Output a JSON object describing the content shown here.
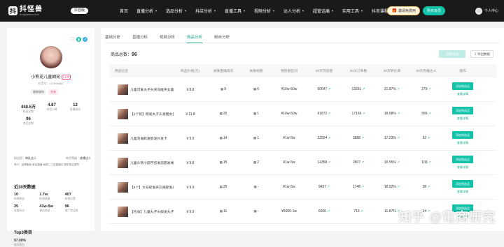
{
  "header": {
    "logo_mark": "抖",
    "logo_title": "抖怪兽",
    "logo_url": "douguaishou.com",
    "version": "抖音版",
    "nav": [
      "首页",
      "直播分析",
      "选品分析",
      "抖店分析",
      "直播工具",
      "视频分析",
      "达人分析",
      "超管话痛",
      "实用工具",
      "抖音课程"
    ],
    "invite_label": "邀请免费用",
    "buy_label": "购买会员",
    "user_label": "个人中心"
  },
  "shop": {
    "name": "小熊花儿童嫡宛",
    "level": "LV.5",
    "id_text": "抖音号：167898864",
    "tags": [
      "服装服饰",
      "女装"
    ],
    "stats": [
      {
        "value": "448.5万",
        "label": "粉丝总数"
      },
      {
        "value": "4.87",
        "label": "带货口碑"
      },
      {
        "value": "12",
        "label": "直播场次"
      },
      {
        "value": "96",
        "label": "商品总数"
      }
    ],
    "meta_a_label": "粉丝团",
    "meta_a_value": "带队达人",
    "meta_b_label": "带货等级",
    "meta_b_value": "欢播达人",
    "description": "简介：品牌服装 新品直播 每周二三四直播中 提供售后保障",
    "data30_title": "近30天数据",
    "data30": [
      {
        "value": "10",
        "label": "新增粉丝"
      },
      {
        "value": "1.7w",
        "label": "新增收藏"
      },
      {
        "value": "407",
        "label": "新增点赞"
      },
      {
        "value": "25",
        "label": "直播场次"
      },
      {
        "value": "41w-5w",
        "label": "预估销量"
      },
      {
        "value": "96",
        "label": "推广商品数"
      }
    ],
    "top3_title": "Top3类目",
    "top3_value": "97.00%",
    "top3_label": "服饰鞋包"
  },
  "main": {
    "tabs": [
      "基础分析",
      "直播分析",
      "视频分析",
      "商品分析",
      "粉丝分析"
    ],
    "active_tab": 3,
    "count_label": "商品总数：",
    "count_value": "96",
    "add_all_label": "批量添加",
    "export_label": "导出数据",
    "columns": [
      "商品信息",
      "商品价格(元)",
      "关联直播场次",
      "关联视频",
      "销售额区间",
      "30天浏览量",
      "30天订单数",
      "30天转化率",
      "30天热推达人",
      "操作"
    ],
    "op_primary": "添加到选品",
    "op_secondary": "查看详情",
    "rows": [
      {
        "name": "儿童可爱丸子头夹马尾夹女童",
        "price": "￥8.8",
        "live": "9",
        "video": "6",
        "sales": "¥10w-50w",
        "views": "60647",
        "orders": "13261",
        "conv": "21.87%",
        "kol": "279"
      },
      {
        "name": "【2个装】假发丸子头发圈女童",
        "price": "￥11.8",
        "live": "25",
        "video": "1",
        "sales": "¥10w-50w",
        "views": "91872",
        "orders": "17166",
        "conv": "18.68%",
        "kol": "999"
      },
      {
        "name": "儿童刘海碎发假发片发卡",
        "price": "￥9.9",
        "live": "14",
        "video": "1",
        "sales": "¥1w-5w",
        "views": "22554",
        "orders": "3888",
        "conv": "17.23%",
        "kol": "92"
      },
      {
        "name": "儿童头饰小圆不伤发皮筋发绳",
        "price": "￥9.8",
        "live": "15",
        "video": "2",
        "sales": "¥1w-5w",
        "views": "14358",
        "orders": "2807",
        "conv": "19.55%",
        "kol": "109"
      },
      {
        "name": "【5个】大号碎发夹刘海碎发夹",
        "price": "￥9.9",
        "live": "25",
        "video": "-",
        "sales": "¥1w-5w",
        "views": "9437",
        "orders": "1748",
        "conv": "18.52%",
        "kol": "38"
      },
      {
        "name": "【托妆】儿童丸子头假发丸子",
        "price": "￥9.9",
        "live": "11",
        "video": "-",
        "sales": "¥5000-1w",
        "views": "6006",
        "orders": "713",
        "conv": "11.87%",
        "kol": "14"
      }
    ]
  },
  "watermark": "知乎 @電商研究"
}
